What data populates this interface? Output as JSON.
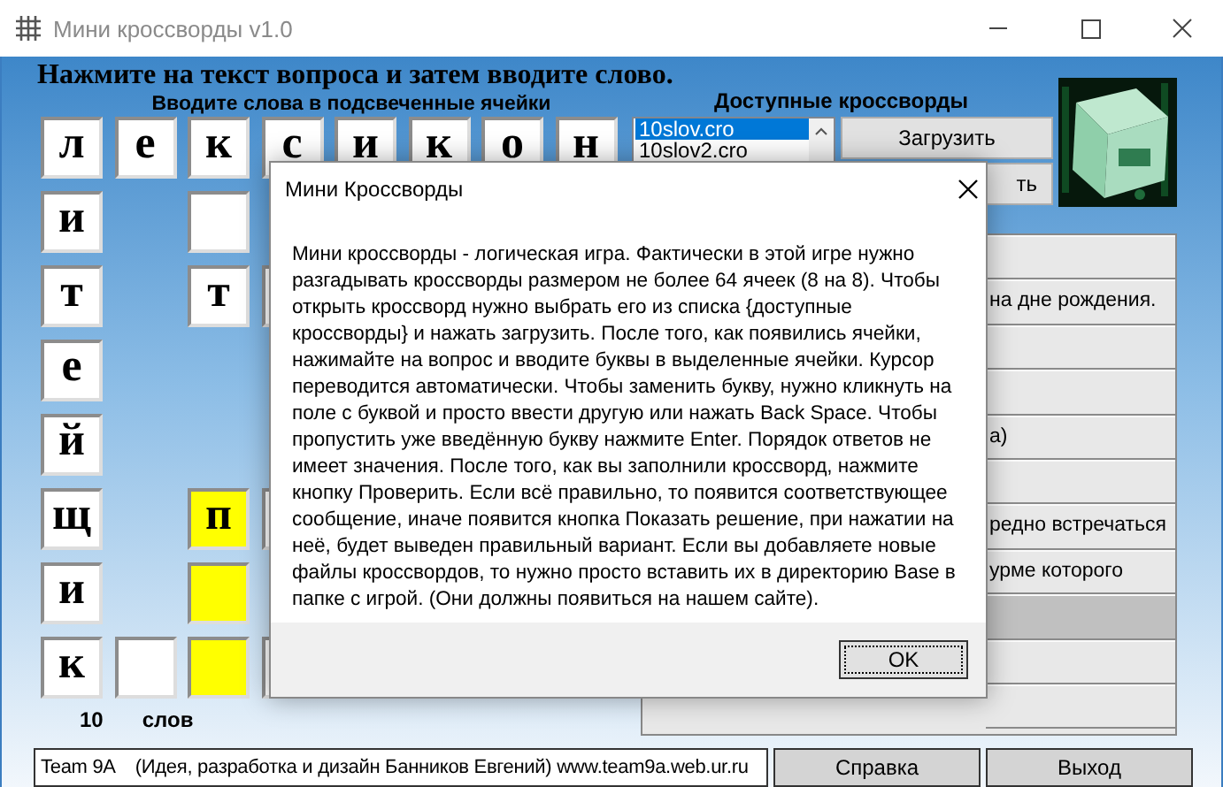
{
  "window": {
    "title": "Мини кроссворды v1.0"
  },
  "instruction": "Нажмите на текст вопроса и затем вводите слово.",
  "grid": {
    "title": "Вводите слова в подсвеченные ячейки",
    "rows": [
      [
        {
          "kind": "cell",
          "letter": "л",
          "highlighted": false
        },
        {
          "kind": "cell",
          "letter": "е",
          "highlighted": false
        },
        {
          "kind": "cell",
          "letter": "к",
          "highlighted": false
        },
        {
          "kind": "cell",
          "letter": "с",
          "highlighted": false
        },
        {
          "kind": "cell",
          "letter": "и",
          "highlighted": false
        },
        {
          "kind": "cell",
          "letter": "к",
          "highlighted": false
        },
        {
          "kind": "cell",
          "letter": "о",
          "highlighted": false
        },
        {
          "kind": "cell",
          "letter": "н",
          "highlighted": false
        }
      ],
      [
        {
          "kind": "cell",
          "letter": "и",
          "highlighted": false
        },
        {
          "kind": "blank"
        },
        {
          "kind": "cell",
          "highlighted": false
        }
      ],
      [
        {
          "kind": "cell",
          "letter": "т",
          "highlighted": false
        },
        {
          "kind": "blank"
        },
        {
          "kind": "cell",
          "letter": "т",
          "highlighted": false
        },
        {
          "kind": "cell",
          "highlighted": false
        }
      ],
      [
        {
          "kind": "cell",
          "letter": "е",
          "highlighted": false
        }
      ],
      [
        {
          "kind": "cell",
          "letter": "й",
          "highlighted": false
        }
      ],
      [
        {
          "kind": "cell",
          "letter": "щ",
          "highlighted": false
        },
        {
          "kind": "blank"
        },
        {
          "kind": "cell",
          "letter": "п",
          "highlighted": true
        },
        {
          "kind": "cell",
          "highlighted": false
        }
      ],
      [
        {
          "kind": "cell",
          "letter": "и",
          "highlighted": false
        },
        {
          "kind": "blank"
        },
        {
          "kind": "cell",
          "highlighted": true
        }
      ],
      [
        {
          "kind": "cell",
          "letter": "к",
          "highlighted": false
        },
        {
          "kind": "cell",
          "highlighted": false
        },
        {
          "kind": "cell",
          "highlighted": true
        },
        {
          "kind": "cell",
          "highlighted": false
        }
      ]
    ],
    "word_count": "10",
    "word_label": "слов"
  },
  "crosswords": {
    "title": "Доступные кроссворды",
    "items": [
      {
        "label": "10slov.cro",
        "selected": true
      },
      {
        "label": "10slov2.cro",
        "selected": false
      }
    ],
    "buttons": [
      "Загрузить",
      "ть"
    ]
  },
  "questions": [
    {
      "selected": false
    },
    {
      "text": "на дне рождения.",
      "selected": false
    },
    {
      "selected": false
    },
    {
      "selected": false
    },
    {
      "text": "а)",
      "selected": false
    },
    {
      "selected": false
    },
    {
      "text": "редно встречаться",
      "selected": false
    },
    {
      "text": "урме которого",
      "selected": false
    },
    {
      "selected": true
    },
    {
      "selected": false
    },
    {
      "selected": false
    }
  ],
  "status_bar": {
    "text": "Team 9A    (Идея, разработка и дизайн Банников Евгений) www.team9a.web.ur.ru",
    "buttons": [
      "Справка",
      "Выход"
    ]
  },
  "dialog": {
    "title": "Мини Кроссворды",
    "message": "Мини кроссворды - логическая игра. Фактически в этой игре нужно разгадывать кроссворды размером не более 64 ячеек (8 на 8). Чтобы открыть кроссворд нужно выбрать его из списка {доступные кроссворды}  и нажать загрузить. После того, как появились ячейки, нажимайте на вопрос и вводите буквы в выделенные ячейки. Курсор переводится автоматически. Чтобы заменить букву, нужно кликнуть на поле с буквой и просто ввести другую или нажать Back Space. Чтобы пропустить уже введённую букву нажмите Enter. Порядок ответов не имеет значения. После того, как вы заполнили кроссворд, нажмите кнопку Проверить. Если всё правильно, то появится соответствующее сообщение, иначе появится кнопка Показать решение, при нажатии на неё, будет выведен правильный вариант. Если вы добавляете новые файлы кроссвордов, то нужно просто вставить их в директорию Base в папке с игрой. (Они должны появиться на нашем сайте).",
    "button": "OK"
  }
}
